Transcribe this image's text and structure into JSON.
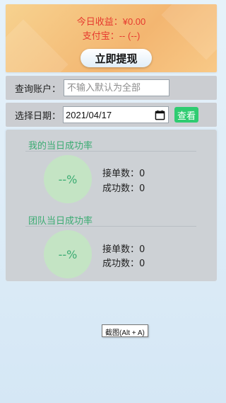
{
  "earnings": {
    "income_label": "今日收益：",
    "income_value": "¥0.00",
    "alipay_label": "支付宝：",
    "alipay_value": "-- (--)",
    "withdraw_label": "立即提现"
  },
  "query": {
    "account_label": "查询账户：",
    "account_placeholder": "不输入默认为全部",
    "account_value": "",
    "date_label": "选择日期：",
    "date_value": "2021/04/17",
    "view_label": "查看"
  },
  "stats": {
    "my": {
      "title": "我的当日成功率",
      "rate": "--%",
      "orders_label": "接单数：",
      "orders_value": "0",
      "success_label": "成功数：",
      "success_value": "0"
    },
    "team": {
      "title": "团队当日成功率",
      "rate": "--%",
      "orders_label": "接单数：",
      "orders_value": "0",
      "success_label": "成功数：",
      "success_value": "0"
    }
  },
  "tooltip": "截图(Alt + A)",
  "colors": {
    "income_text": "#e63a2f",
    "accent_green": "#2ecc71",
    "section_green": "#3bab72",
    "circle_fill": "#c4e4c4",
    "panel_orange": "#f3b671"
  },
  "icons": {
    "date_picker": "calendar-icon"
  }
}
